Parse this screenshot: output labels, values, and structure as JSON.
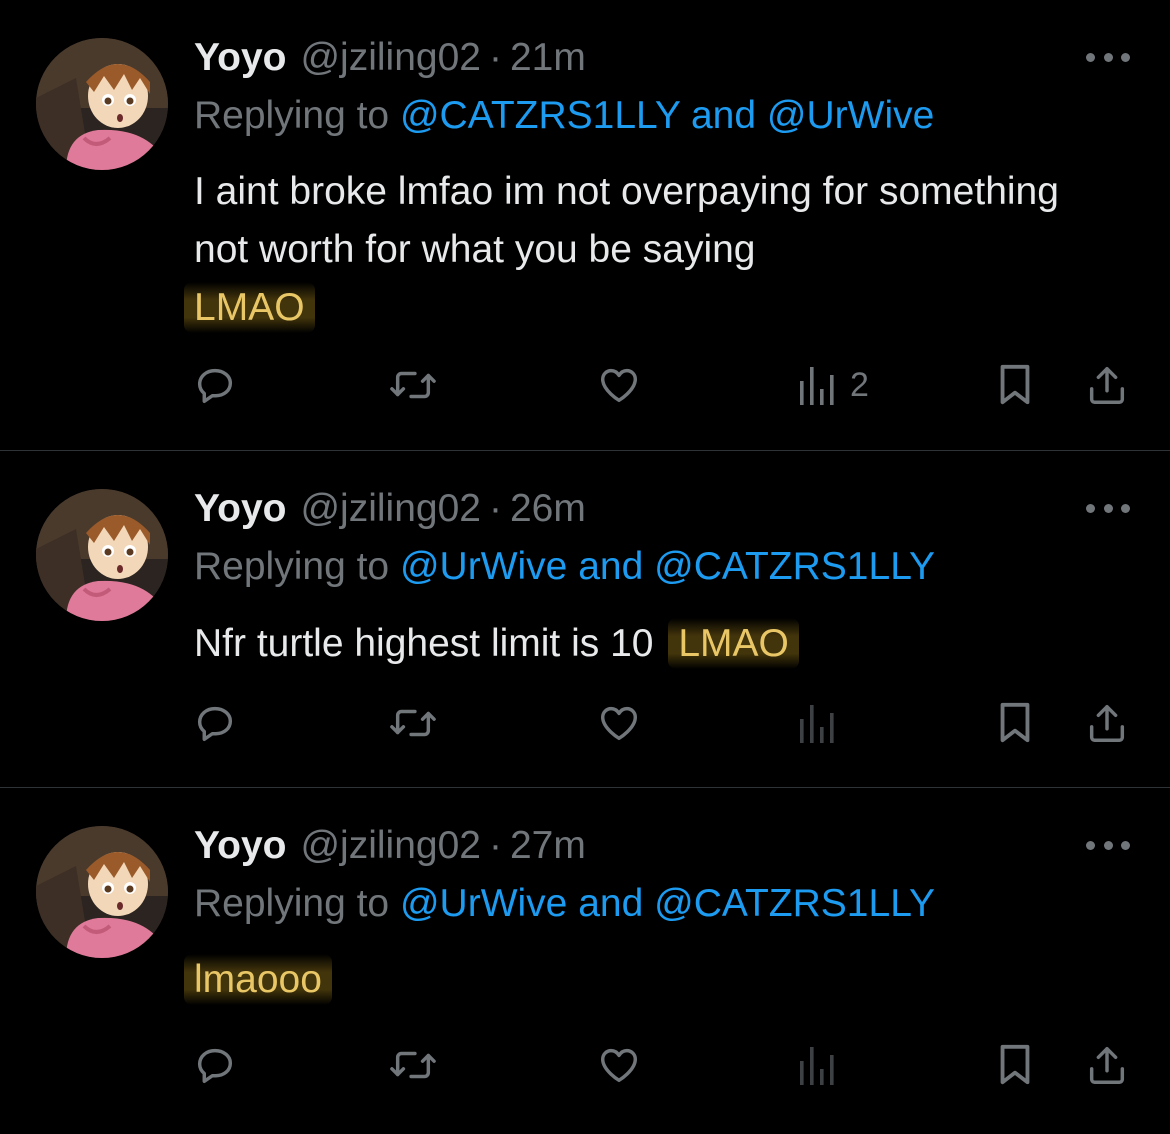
{
  "tweets": [
    {
      "name": "Yoyo",
      "handle": "@jziling02",
      "separator": "·",
      "time": "21m",
      "replying_prefix": "Replying to",
      "replying_to": "@CATZRS1LLY and @UrWive",
      "text": "I aint broke lmfao im not overpaying for something not worth for what you be saying",
      "highlighted": "LMAO",
      "views": "2"
    },
    {
      "name": "Yoyo",
      "handle": "@jziling02",
      "separator": "·",
      "time": "26m",
      "replying_prefix": "Replying to",
      "replying_to": "@UrWive and @CATZRS1LLY",
      "text": "Nfr turtle highest limit is 10",
      "highlighted": "LMAO",
      "views": ""
    },
    {
      "name": "Yoyo",
      "handle": "@jziling02",
      "separator": "·",
      "time": "27m",
      "replying_prefix": "Replying to",
      "replying_to": "@UrWive and @CATZRS1LLY",
      "text": "",
      "highlighted": "lmaooo",
      "views": ""
    }
  ],
  "icons": {
    "more": "more-horizontal-icon",
    "reply": "reply-bubble-icon",
    "retweet": "retweet-icon",
    "like": "heart-icon",
    "views": "views-bar-chart-icon",
    "bookmark": "bookmark-icon",
    "share": "share-icon"
  },
  "colors": {
    "background": "#000000",
    "text": "#e7e9ea",
    "muted": "#71767b",
    "link": "#1d9bf0",
    "highlight_text": "#e9c766",
    "divider": "#2f3336"
  }
}
